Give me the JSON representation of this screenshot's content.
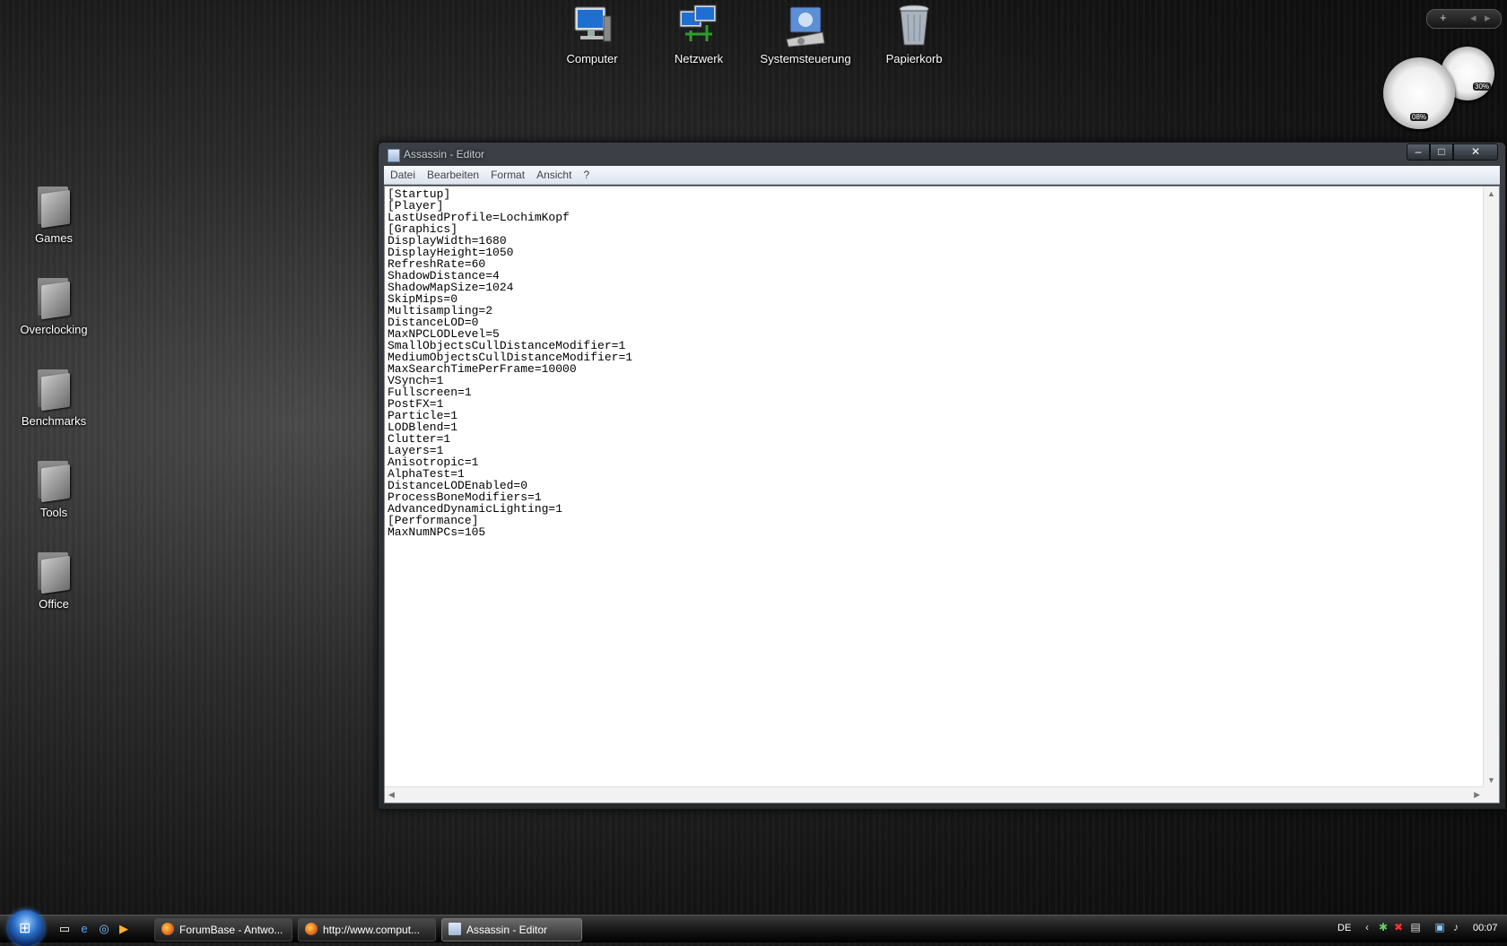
{
  "desktop": {
    "top_icons": [
      {
        "label": "Computer",
        "icon": "computer-icon"
      },
      {
        "label": "Netzwerk",
        "icon": "network-icon"
      },
      {
        "label": "Systemsteuerung",
        "icon": "control-panel-icon"
      },
      {
        "label": "Papierkorb",
        "icon": "recycle-bin-icon"
      }
    ],
    "side_icons": [
      {
        "label": "Games",
        "icon": "folder-icon"
      },
      {
        "label": "Overclocking",
        "icon": "folder-icon"
      },
      {
        "label": "Benchmarks",
        "icon": "folder-icon"
      },
      {
        "label": "Tools",
        "icon": "folder-icon"
      },
      {
        "label": "Office",
        "icon": "folder-icon"
      }
    ]
  },
  "gadget": {
    "cpu": "08%",
    "ram": "30%"
  },
  "sidebar_controls": {
    "add": "+",
    "prev": "◂",
    "next": "▸"
  },
  "window": {
    "title": "Assassin - Editor",
    "controls": {
      "minimize": "–",
      "maximize": "□",
      "close": "✕"
    },
    "menu": [
      "Datei",
      "Bearbeiten",
      "Format",
      "Ansicht",
      "?"
    ],
    "content": "[Startup]\n[Player]\nLastUsedProfile=LochimKopf\n[Graphics]\nDisplayWidth=1680\nDisplayHeight=1050\nRefreshRate=60\nShadowDistance=4\nShadowMapSize=1024\nSkipMips=0\nMultisampling=2\nDistanceLOD=0\nMaxNPCLODLevel=5\nSmallObjectsCullDistanceModifier=1\nMediumObjectsCullDistanceModifier=1\nMaxSearchTimePerFrame=10000\nVSynch=1\nFullscreen=1\nPostFX=1\nParticle=1\nLODBlend=1\nClutter=1\nLayers=1\nAnisotropic=1\nAlphaTest=1\nDistanceLODEnabled=0\nProcessBoneModifiers=1\nAdvancedDynamicLighting=1\n[Performance]\nMaxNumNPCs=105"
  },
  "taskbar": {
    "buttons": [
      {
        "label": "ForumBase - Antwo...",
        "icon": "firefox-icon"
      },
      {
        "label": "http://www.comput...",
        "icon": "firefox-icon"
      },
      {
        "label": "Assassin - Editor",
        "icon": "notepad-icon"
      }
    ],
    "language": "DE",
    "clock": "00:07"
  }
}
